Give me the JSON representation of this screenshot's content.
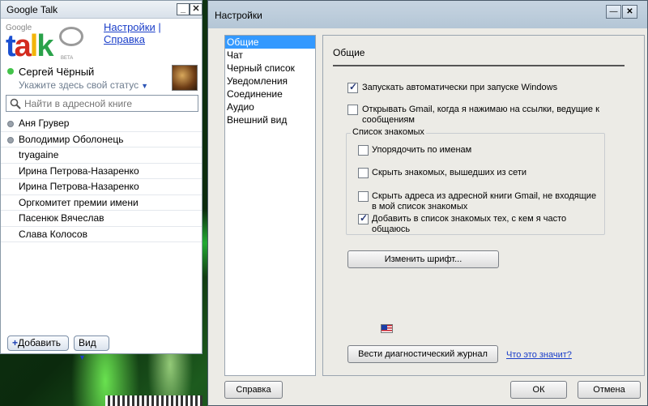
{
  "gtalk": {
    "title": "Google Talk",
    "window_buttons": {
      "minimize": "_",
      "close": "✕"
    },
    "logo": {
      "google": "Google",
      "talk": "talk",
      "beta": "BETA"
    },
    "links": {
      "settings": "Настройки",
      "separator": "|",
      "help": "Справка"
    },
    "user": {
      "name": "Сергей Чёрный",
      "status_placeholder": "Укажите здесь свой статус",
      "status_caret": "▼"
    },
    "search": {
      "placeholder": "Найти в адресной книге"
    },
    "contacts": [
      {
        "name": "Аня Грувер",
        "presence": "offline-gray"
      },
      {
        "name": "Володимир Оболонець",
        "presence": "offline-gray"
      },
      {
        "name": "tryagaine",
        "presence": "none"
      },
      {
        "name": "Ирина Петрова-Назаренко",
        "presence": "none"
      },
      {
        "name": "Ирина Петрова-Назаренко",
        "presence": "none"
      },
      {
        "name": "Оргкомитет премии имени",
        "presence": "none"
      },
      {
        "name": "Пасенюк Вячеслав",
        "presence": "none"
      },
      {
        "name": "Слава Колосов",
        "presence": "none"
      }
    ],
    "add_button": {
      "plus": "+",
      "label": "Добавить"
    },
    "view_button": {
      "label": "Вид",
      "caret": "▼"
    }
  },
  "settings": {
    "title": "Настройки",
    "window_buttons": {
      "minimize": "—",
      "close": "✕"
    },
    "nav": [
      {
        "label": "Общие",
        "selected": true
      },
      {
        "label": "Чат",
        "selected": false
      },
      {
        "label": "Черный список",
        "selected": false
      },
      {
        "label": "Уведомления",
        "selected": false
      },
      {
        "label": "Соединение",
        "selected": false
      },
      {
        "label": "Аудио",
        "selected": false
      },
      {
        "label": "Внешний вид",
        "selected": false
      }
    ],
    "section_title": "Общие",
    "options": {
      "autostart": {
        "label": "Запускать автоматически при запуске Windows",
        "checked": true
      },
      "gmail_links": {
        "label": "Открывать Gmail, когда я нажимаю на ссылки, ведущие к сообщениям",
        "checked": false
      }
    },
    "friends_group": {
      "title": "Список знакомых",
      "sort_by_name": {
        "label": "Упорядочить по именам",
        "checked": false
      },
      "hide_offline": {
        "label": "Скрыть знакомых, вышедших из сети",
        "checked": false
      },
      "hide_addresses": {
        "label": "Скрыть адреса из адресной книги Gmail, не входящие в мой список знакомых",
        "checked": false
      },
      "add_frequent": {
        "label": "Добавить в список знакомых тех, с кем я часто общаюсь",
        "checked": true
      }
    },
    "change_font_button": "Изменить шрифт...",
    "diagnostic_log_button": "Вести диагностический журнал",
    "what_does_it_mean_link": "Что это значит?",
    "help_button": "Справка",
    "ok_button": "ОК",
    "cancel_button": "Отмена"
  }
}
